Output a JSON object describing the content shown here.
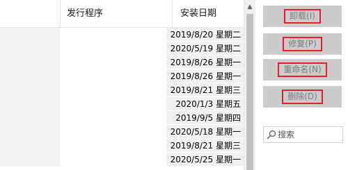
{
  "list": {
    "columns": {
      "publisher": "发行程序",
      "installed_on": "安装日期"
    },
    "rows": [
      {
        "date": "2019/8/20 星期二"
      },
      {
        "date": "2020/5/19 星期二"
      },
      {
        "date": "2019/8/26 星期一"
      },
      {
        "date": "2019/8/26 星期一"
      },
      {
        "date": "2019/8/21 星期三"
      },
      {
        "date": "2020/1/3 星期五"
      },
      {
        "date": "2019/9/5 星期四"
      },
      {
        "date": "2020/5/18 星期一"
      },
      {
        "date": "2019/8/21 星期三"
      },
      {
        "date": "2020/5/25 星期一"
      }
    ]
  },
  "actions": {
    "uninstall": "卸载(I)",
    "repair": "修复(P)",
    "rename": "重命名(N)",
    "delete": "删除(D)"
  },
  "search": {
    "placeholder": "搜索",
    "icon": "search-icon"
  },
  "colors": {
    "highlight_border": "#e0202a",
    "button_bg": "#cccccc",
    "button_text": "#7a7a7a"
  }
}
